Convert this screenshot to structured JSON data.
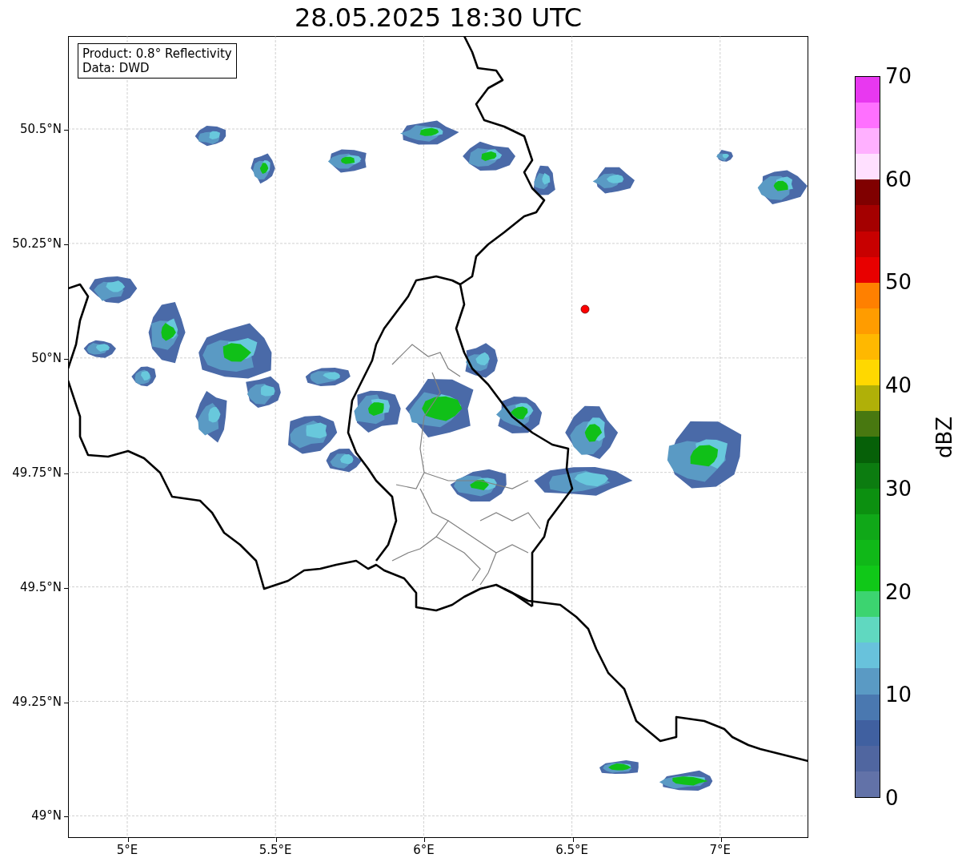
{
  "title": "28.05.2025 18:30 UTC",
  "legend": {
    "lines": [
      "Product: 0.8° Reflectivity",
      "Data: DWD"
    ]
  },
  "map": {
    "x_ticks": [
      "5°E",
      "5.5°E",
      "6°E",
      "6.5°E",
      "7°E"
    ],
    "y_ticks": [
      "50.5°N",
      "50.25°N",
      "50°N",
      "49.75°N",
      "49.5°N",
      "49.25°N",
      "49°N"
    ]
  },
  "colorbar": {
    "label": "dBZ",
    "ticks": [
      "70",
      "60",
      "50",
      "40",
      "30",
      "20",
      "10",
      "0"
    ],
    "segments": [
      {
        "color": "#6272a8"
      },
      {
        "color": "#5066a0"
      },
      {
        "color": "#4060a0"
      },
      {
        "color": "#4a78b0"
      },
      {
        "color": "#5a9ac4"
      },
      {
        "color": "#68c2dc"
      },
      {
        "color": "#60d8c0"
      },
      {
        "color": "#3cd470"
      },
      {
        "color": "#10c818"
      },
      {
        "color": "#10b818"
      },
      {
        "color": "#10a818"
      },
      {
        "color": "#0c9010"
      },
      {
        "color": "#0c7c10"
      },
      {
        "color": "#066008"
      },
      {
        "color": "#487810"
      },
      {
        "color": "#b0b008"
      },
      {
        "color": "#ffd800"
      },
      {
        "color": "#ffb800"
      },
      {
        "color": "#ff9c00"
      },
      {
        "color": "#ff8000"
      },
      {
        "color": "#e80000"
      },
      {
        "color": "#c80000"
      },
      {
        "color": "#a40000"
      },
      {
        "color": "#800000"
      },
      {
        "color": "#ffe0ff"
      },
      {
        "color": "#ffb0ff"
      },
      {
        "color": "#ff70ff"
      },
      {
        "color": "#e838f0"
      }
    ]
  }
}
